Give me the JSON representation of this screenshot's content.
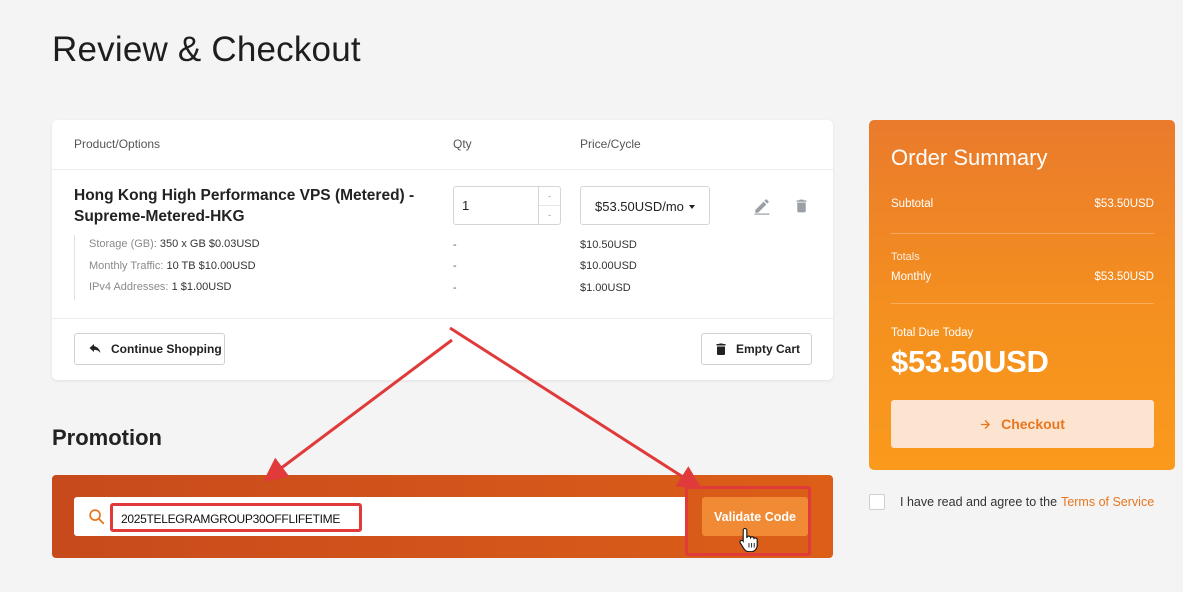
{
  "page": {
    "title": "Review & Checkout"
  },
  "cart": {
    "headers": {
      "product": "Product/Options",
      "qty": "Qty",
      "price": "Price/Cycle"
    },
    "product_name": "Hong Kong High Performance VPS (Metered) - Supreme-Metered-HKG",
    "qty": "1",
    "price_cycle": "$53.50USD/mo",
    "options": [
      {
        "label": "Storage (GB):",
        "value": "350 x GB $0.03USD",
        "qty": "-",
        "price": "$10.50USD"
      },
      {
        "label": "Monthly Traffic:",
        "value": "10 TB $10.00USD",
        "qty": "-",
        "price": "$10.00USD"
      },
      {
        "label": "IPv4 Addresses:",
        "value": "1 $1.00USD",
        "qty": "-",
        "price": "$1.00USD"
      }
    ],
    "continue_label": "Continue Shopping",
    "empty_label": "Empty Cart"
  },
  "promotion": {
    "title": "Promotion",
    "code": "2025TELEGRAMGROUP30OFFLIFETIME",
    "validate_label": "Validate Code"
  },
  "summary": {
    "title": "Order Summary",
    "subtotal_label": "Subtotal",
    "subtotal_value": "$53.50USD",
    "totals_label": "Totals",
    "monthly_label": "Monthly",
    "monthly_value": "$53.50USD",
    "due_label": "Total Due Today",
    "due_value": "$53.50USD",
    "checkout_label": "Checkout"
  },
  "tos": {
    "text": "I have read and agree to the",
    "link": "Terms of Service"
  },
  "colors": {
    "accent": "#f08a34",
    "promo_bg": "#d4561a",
    "annotation": "#e03a3a"
  },
  "icons": [
    "edit-icon",
    "trash-icon",
    "reply-arrow-icon",
    "search-icon",
    "arrow-right-icon",
    "hand-cursor-icon"
  ]
}
